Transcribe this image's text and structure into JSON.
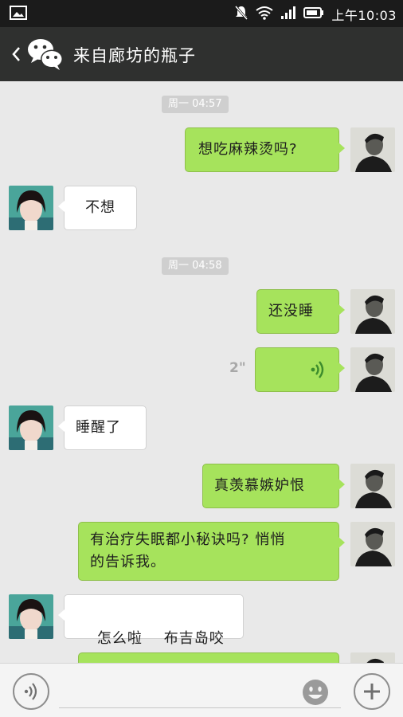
{
  "status_bar": {
    "time": "上午10:03",
    "icons": [
      "image-icon",
      "mute-icon",
      "wifi-icon",
      "signal-icon",
      "battery-icon"
    ]
  },
  "header": {
    "title": "来自廊坊的瓶子",
    "icons": [
      "back-chevron-icon",
      "wechat-logo-icon"
    ]
  },
  "messages": [
    {
      "type": "timestamp",
      "text": "周一 04:57"
    },
    {
      "type": "text",
      "from": "me",
      "text": "想吃麻辣烫吗?"
    },
    {
      "type": "text",
      "from": "her",
      "text": "不想"
    },
    {
      "type": "timestamp",
      "text": "周一 04:58"
    },
    {
      "type": "text",
      "from": "me",
      "text": "还没睡"
    },
    {
      "type": "voice",
      "from": "me",
      "duration": "2\""
    },
    {
      "type": "text",
      "from": "her",
      "text": "睡醒了"
    },
    {
      "type": "text",
      "from": "me",
      "text": "真羡慕嫉妒恨"
    },
    {
      "type": "text",
      "from": "me",
      "text_line1": "有治疗失眠都小秘诀吗? 悄悄",
      "text_line2": "的告诉我。"
    },
    {
      "type": "text",
      "from": "her",
      "text": "怎么啦    布吉岛咬"
    }
  ],
  "input_bar": {
    "icons": [
      "voice-mode-icon",
      "emoji-icon",
      "plus-icon"
    ],
    "placeholder": ""
  },
  "colors": {
    "my_bubble": "#a6e35c",
    "her_bubble": "#ffffff",
    "header_bg": "#2f302f",
    "chat_bg": "#e9e9e9"
  }
}
